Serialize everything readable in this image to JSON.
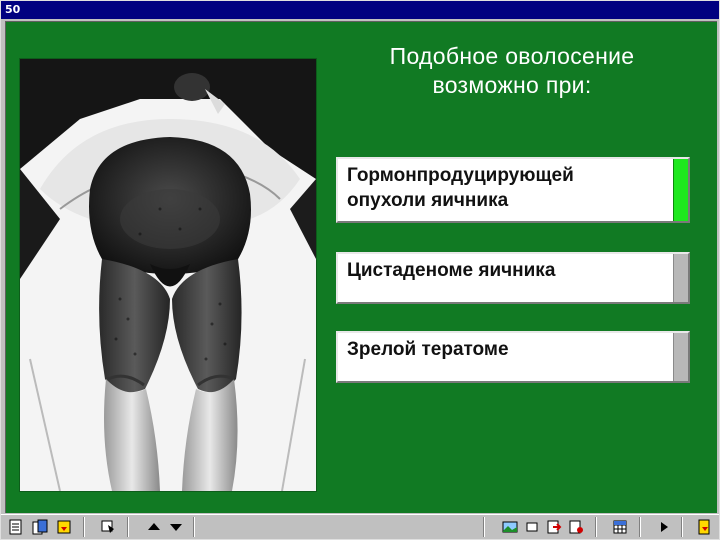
{
  "window": {
    "title": "50"
  },
  "question": {
    "line1": "Подобное оволосение",
    "line2": "возможно при:"
  },
  "answers": [
    {
      "line1": "Гормонпродуцирующей",
      "line2": "опухоли яичника",
      "state": "correct"
    },
    {
      "line1": "Цистаденоме яичника",
      "line2": "",
      "state": "neutral"
    },
    {
      "line1": "Зрелой тератоме",
      "line2": "",
      "state": "neutral"
    }
  ],
  "colors": {
    "background": "#117a23",
    "correct_indicator": "#1ee81e",
    "neutral_indicator": "#b8b8b8",
    "titlebar": "#000080"
  },
  "toolbar": {
    "left_icons": [
      "notes-icon",
      "clipboard-icon",
      "exit-icon",
      "print-icon",
      "previous-icon",
      "next-icon"
    ],
    "right_icons": [
      "picture-icon",
      "window-icon",
      "close-icon",
      "help-icon",
      "calculator-icon",
      "play-icon",
      "exit-door-icon"
    ]
  }
}
